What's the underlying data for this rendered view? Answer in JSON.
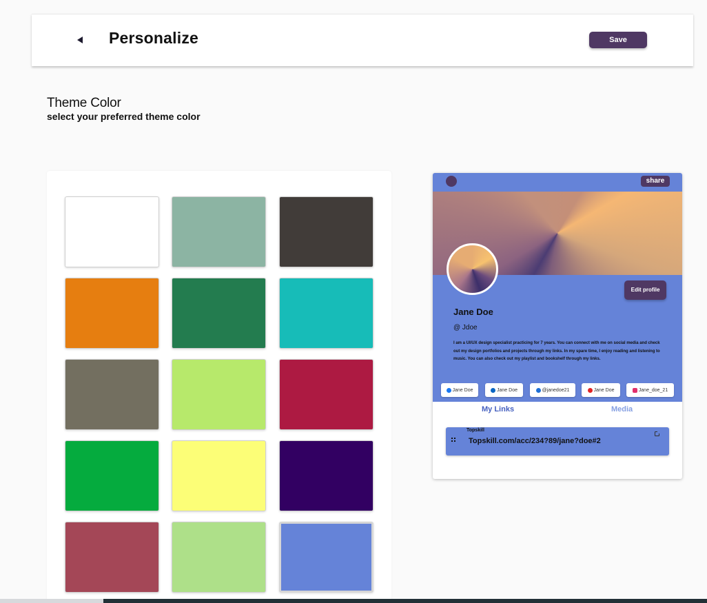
{
  "header": {
    "title": "Personalize",
    "save_label": "Save"
  },
  "theme": {
    "title": "Theme Color",
    "subtitle": "select your preferred theme color"
  },
  "swatches": [
    "#ffffff",
    "#8cb4a3",
    "#413c39",
    "#e67e10",
    "#237c4f",
    "#17bcb8",
    "#736f60",
    "#b7e96b",
    "#ad1a42",
    "#05ab3e",
    "#fcfe77",
    "#320062",
    "#a44757",
    "#aee089",
    "#6583d8"
  ],
  "selected_swatch_index": 14,
  "preview": {
    "share_label": "share",
    "edit_label": "Edit profile",
    "name": "Jane Doe",
    "handle": "@ Jdoe",
    "bio": "I am a UI/UX design specialist practicing for 7 years. You can connect with me on social media and check out my design portfolios and projects through my links. In my spare time, I enjoy reading and listening to music. You can also check out my playlist and bookshelf through my links.",
    "socials": [
      {
        "label": "Jane Doe",
        "icon": "facebook-icon",
        "color": "#1877f2"
      },
      {
        "label": "Jane Doe",
        "icon": "linkedin-icon",
        "color": "#0a66c2"
      },
      {
        "label": "@janedoe21",
        "icon": "twitter-icon",
        "color": "#1d6fd6"
      },
      {
        "label": "Jane Doe",
        "icon": "youtube-icon",
        "color": "#e02424"
      },
      {
        "label": "Jane_doe_21",
        "icon": "instagram-icon",
        "color": "#e1306c"
      }
    ],
    "tabs": [
      "My Links",
      "Media"
    ],
    "link": {
      "title": "Topskill",
      "url": "Topskill.com/acc/234?89/jane?doe#2"
    }
  },
  "colors": {
    "accent": "#4f3863",
    "theme": "#6583d8"
  }
}
